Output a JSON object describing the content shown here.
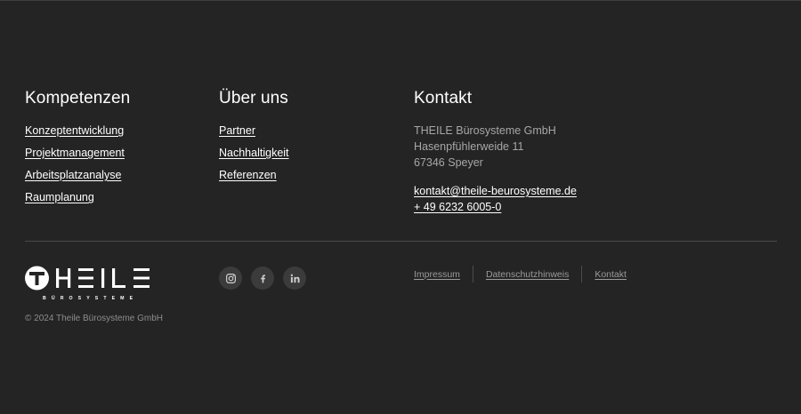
{
  "columns": {
    "kompetenzen": {
      "heading": "Kompetenzen",
      "links": [
        "Konzeptentwicklung",
        "Projektmanagement",
        "Arbeitsplatzanalyse",
        "Raumplanung"
      ]
    },
    "ueber_uns": {
      "heading": "Über uns",
      "links": [
        "Partner",
        "Nachhaltigkeit",
        "Referenzen"
      ]
    },
    "kontakt": {
      "heading": "Kontakt",
      "company": "THEILE Bürosysteme GmbH",
      "street": "Hasenpfühlerweide 11",
      "city": "67346 Speyer",
      "email": "kontakt@theile-beurosysteme.de",
      "phone": "+ 49 6232 6005-0"
    }
  },
  "brand": {
    "logo_text": "THEILE",
    "logo_subtext": "BÜROSYSTEME",
    "copyright": "© 2024 Theile Bürosysteme GmbH"
  },
  "social": [
    {
      "icon": "instagram-icon"
    },
    {
      "icon": "facebook-icon"
    },
    {
      "icon": "linkedin-icon"
    }
  ],
  "legal_links": [
    "Impressum",
    "Datenschutzhinweis",
    "Kontakt"
  ],
  "colors": {
    "background": "#242424",
    "text": "#ffffff",
    "muted": "#a7a7a7",
    "divider": "#4a4a4a",
    "social_bg": "#3b3b3b"
  }
}
